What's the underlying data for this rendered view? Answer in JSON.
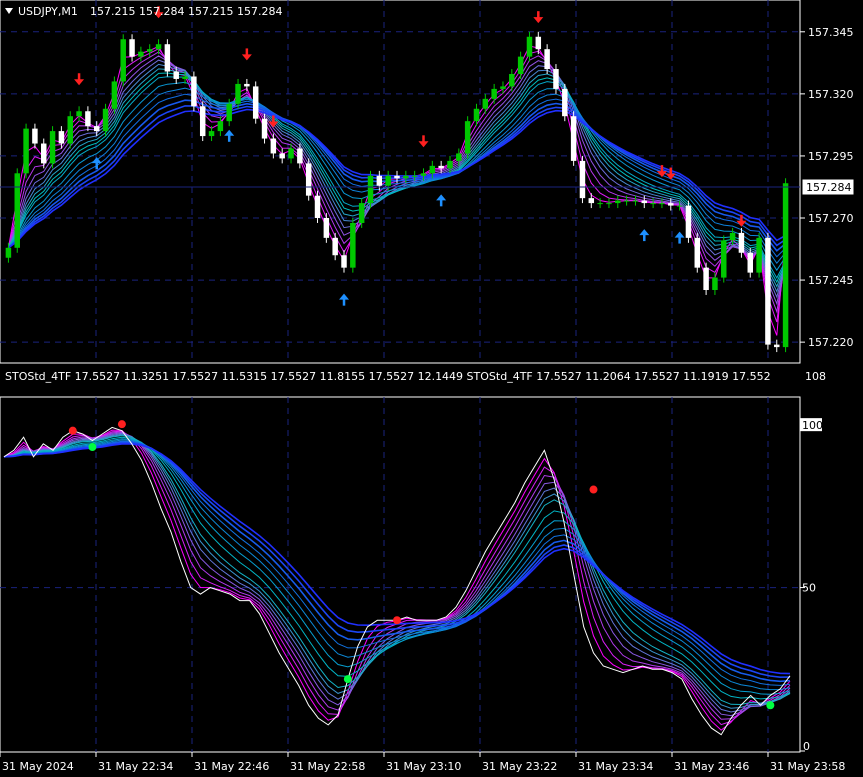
{
  "header": {
    "title": "USDJPY,M1",
    "ohlc": "157.215 157.284 157.215 157.284"
  },
  "subwindow": {
    "title": "STOStd_4TF 17.5527 11.3251 17.5527 11.5315 17.5527 11.8155 17.5527 12.1449   STOStd_4TF 17.5527 11.2064 17.5527 11.1919 17.552",
    "max_label": "108"
  },
  "colors": {
    "background": "#000000",
    "grid": "#1a237e",
    "bull": "#00c800",
    "bear": "#ffffff",
    "magenta": "#ff00ff",
    "cyan": "#00c0c0",
    "blue": "#2030ff",
    "arrow_up": "#1e90ff",
    "arrow_down": "#ff2020",
    "dot_red": "#ff2020",
    "dot_green": "#00ff40"
  },
  "chart_data": [
    {
      "type": "candlestick",
      "symbol": "USDJPY",
      "timeframe": "M1",
      "ylim": [
        157.212,
        157.357
      ],
      "y_ticks": [
        "157.345",
        "157.320",
        "157.295",
        "157.270",
        "157.245",
        "157.220"
      ],
      "current_price": "157.284",
      "close": [
        157.258,
        157.288,
        157.306,
        157.3,
        157.292,
        157.305,
        157.3,
        157.311,
        157.313,
        157.307,
        157.305,
        157.314,
        157.325,
        157.342,
        157.335,
        157.337,
        157.338,
        157.34,
        157.329,
        157.326,
        157.327,
        157.315,
        157.303,
        157.305,
        157.309,
        157.316,
        157.324,
        157.323,
        157.31,
        157.302,
        157.296,
        157.294,
        157.298,
        157.292,
        157.279,
        157.27,
        157.262,
        157.255,
        157.25,
        157.268,
        157.276,
        157.287,
        157.283,
        157.287,
        157.286,
        157.287,
        157.287,
        157.288,
        157.291,
        157.29,
        157.293,
        157.296,
        157.309,
        157.314,
        157.318,
        157.322,
        157.323,
        157.328,
        157.335,
        157.343,
        157.338,
        157.33,
        157.322,
        157.311,
        157.293,
        157.278,
        157.276,
        157.276,
        157.276,
        157.277,
        157.277,
        157.277,
        157.276,
        157.276,
        157.276,
        157.275,
        157.275,
        157.262,
        157.25,
        157.241,
        157.246,
        157.261,
        157.264,
        157.256,
        157.248,
        157.262,
        157.219,
        157.218,
        157.284
      ],
      "buy_arrows_at_bar": [
        10,
        25,
        38,
        49,
        72,
        76,
        92
      ],
      "sell_arrows_at_bar": [
        8,
        17,
        27,
        30,
        47,
        60,
        74,
        75,
        83,
        90
      ]
    },
    {
      "type": "line",
      "indicator": "STOStd_4TF",
      "ylim": [
        0,
        108
      ],
      "y_ticks": [
        "100",
        "50",
        "0"
      ],
      "series": [
        {
          "values": [
            90,
            92,
            96,
            90,
            94,
            92,
            96,
            98,
            97,
            95,
            97,
            99,
            98,
            94,
            89,
            82,
            74,
            67,
            58,
            50,
            48,
            50,
            49,
            48,
            46,
            46,
            42,
            36,
            30,
            25,
            20,
            14,
            10,
            8,
            11,
            22,
            32,
            38,
            40,
            40,
            40,
            41,
            40,
            40,
            40,
            41,
            44,
            49,
            55,
            61,
            66,
            71,
            76,
            82,
            87,
            92,
            83,
            70,
            54,
            38,
            30,
            26,
            25,
            24,
            25,
            26,
            25,
            25,
            24,
            22,
            16,
            11,
            7,
            5,
            10,
            14,
            17,
            14,
            17,
            19,
            23
          ]
        }
      ],
      "red_dots": [
        {
          "x": 7,
          "y": 98
        },
        {
          "x": 12,
          "y": 100
        },
        {
          "x": 40,
          "y": 40
        },
        {
          "x": 60,
          "y": 80
        }
      ],
      "green_dots": [
        {
          "x": 9,
          "y": 93
        },
        {
          "x": 35,
          "y": 22
        },
        {
          "x": 78,
          "y": 14
        }
      ]
    }
  ],
  "time_axis": [
    "31 May 2024",
    "31 May 22:34",
    "31 May 22:46",
    "31 May 22:58",
    "31 May 23:10",
    "31 May 23:22",
    "31 May 23:34",
    "31 May 23:46",
    "31 May 23:58"
  ]
}
